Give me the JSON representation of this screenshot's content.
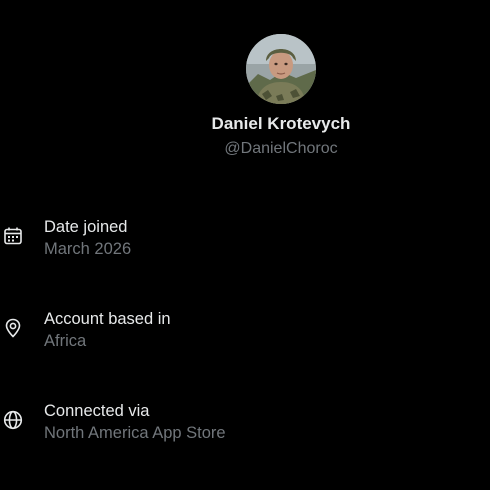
{
  "profile": {
    "avatar_alt": "profile-photo",
    "display_name": "Daniel Krotevych",
    "handle": "@DanielChoroc"
  },
  "about": {
    "items": [
      {
        "icon": "calendar-icon",
        "label": "Date joined",
        "value": "March 2026"
      },
      {
        "icon": "location-pin-icon",
        "label": "Account based in",
        "value": "Africa"
      },
      {
        "icon": "globe-icon",
        "label": "Connected via",
        "value": "North America App Store"
      }
    ]
  },
  "colors": {
    "background": "#000000",
    "primary_text": "#e7e9ea",
    "secondary_text": "#71767b"
  }
}
